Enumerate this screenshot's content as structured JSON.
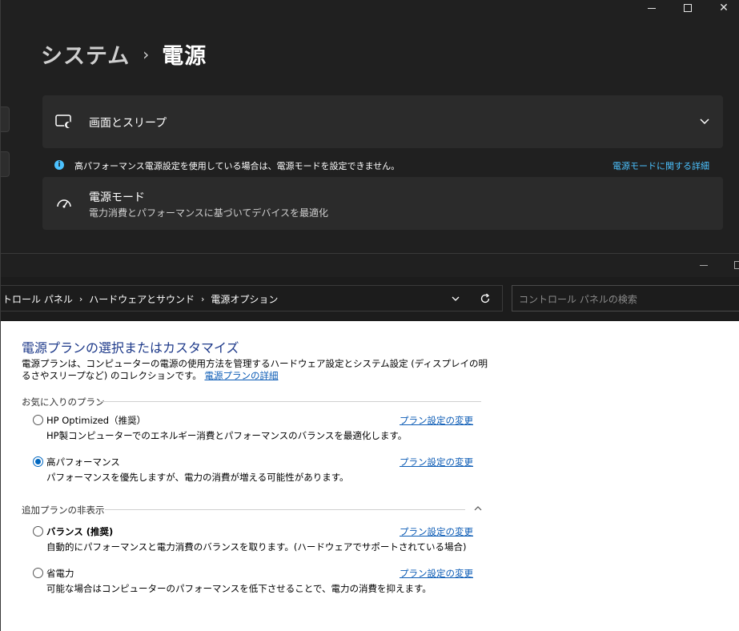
{
  "settings": {
    "breadcrumb_parent": "システム",
    "breadcrumb_sep": "›",
    "breadcrumb_current": "電源",
    "cards": [
      {
        "label": "画面とスリープ",
        "icon": "screen-sleep-icon"
      },
      {
        "label": "電源モード",
        "sub": "電力消費とパフォーマンスに基づいてデバイスを最適化",
        "icon": "power-mode-gauge-icon"
      }
    ],
    "info_text": "高パフォーマンス電源設定を使用している場合は、電源モードを設定できません。",
    "info_link": "電源モードに関する詳細",
    "info_glyph": "i"
  },
  "control_panel": {
    "address": [
      "トロール パネル",
      "ハードウェアとサウンド",
      "電源オプション"
    ],
    "address_sep": "›",
    "search_placeholder": "コントロール パネルの検索",
    "heading": "電源プランの選択またはカスタマイズ",
    "description": "電源プランは、コンピューターの電源の使用方法を管理するハードウェア設定とシステム設定 (ディスプレイの明るさやスリープなど) のコレクションです。",
    "description_link": "電源プランの詳細",
    "favorites_label": "お気に入りのプラン",
    "hidden_label": "追加プランの非表示",
    "change_link": "プラン設定の変更",
    "plans": [
      {
        "name": "HP Optimized（推奨）",
        "desc": "HP製コンピューターでのエネルギー消費とパフォーマンスのバランスを最適化します。",
        "selected": false
      },
      {
        "name": "高パフォーマンス",
        "desc": "パフォーマンスを優先しますが、電力の消費が増える可能性があります。",
        "selected": true
      },
      {
        "name": "バランス (推奨)",
        "desc": "自動的にパフォーマンスと電力消費のバランスを取ります。(ハードウェアでサポートされている場合)",
        "selected": false
      },
      {
        "name": "省電力",
        "desc": "可能な場合はコンピューターのパフォーマンスを低下させることで、電力の消費を抑えます。",
        "selected": false
      }
    ]
  },
  "colors": {
    "accent_link_dark": "#4cc2ff",
    "accent_link_light": "#0b5bb5",
    "heading": "#1e3a8a",
    "radio_selected": "#0067c0"
  }
}
